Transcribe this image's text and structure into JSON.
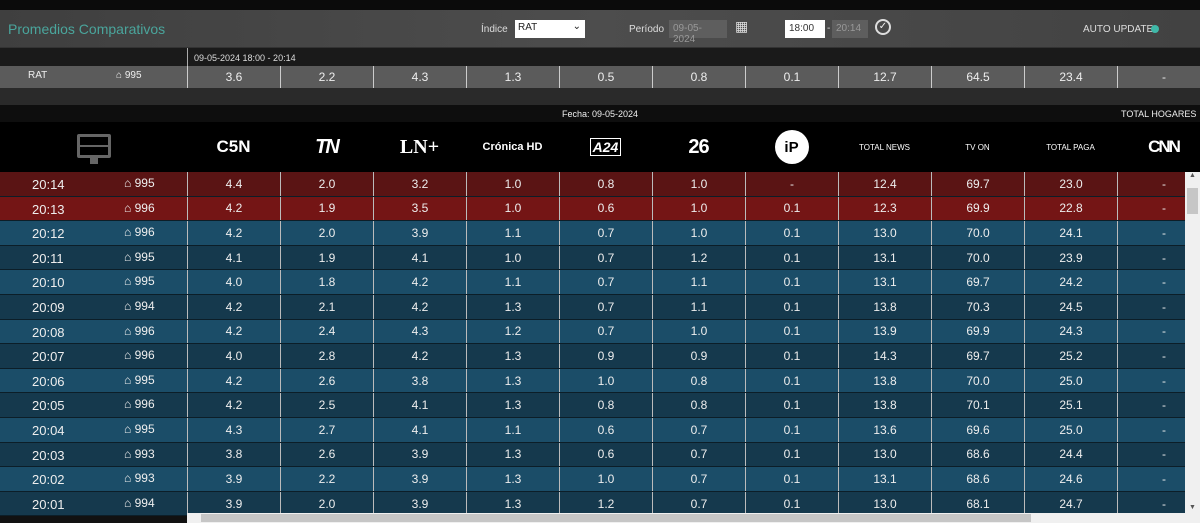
{
  "header": {
    "title": "Promedios Comparativos",
    "indice_label": "Índice",
    "indice_value": "RAT",
    "periodo_label": "Período",
    "periodo_value": "09-05-2024",
    "time_from": "18:00",
    "time_to": "20:14",
    "auto_update": "AUTO UPDATE",
    "auto_update_color": "#3fb8a8"
  },
  "range_label": "09-05-2024 18:00 - 20:14",
  "summary": {
    "label": "RAT",
    "homes": "995",
    "values": [
      "3.6",
      "2.2",
      "4.3",
      "1.3",
      "0.5",
      "0.8",
      "0.1",
      "12.7",
      "64.5",
      "23.4",
      "-"
    ]
  },
  "fecha": "Fecha: 09-05-2024",
  "total_hogares": "TOTAL HOGARES",
  "columns": [
    "C5N",
    "TN",
    "LN+",
    "Crónica HD",
    "A24",
    "26",
    "iP",
    "TOTAL NEWS",
    "TV ON",
    "TOTAL PAGA",
    "CNN"
  ],
  "rows": [
    {
      "time": "20:14",
      "homes": "995",
      "values": [
        "4.4",
        "2.0",
        "3.2",
        "1.0",
        "0.8",
        "1.0",
        "-",
        "12.4",
        "69.7",
        "23.0",
        "-"
      ]
    },
    {
      "time": "20:13",
      "homes": "996",
      "values": [
        "4.2",
        "1.9",
        "3.5",
        "1.0",
        "0.6",
        "1.0",
        "0.1",
        "12.3",
        "69.9",
        "22.8",
        "-"
      ]
    },
    {
      "time": "20:12",
      "homes": "996",
      "values": [
        "4.2",
        "2.0",
        "3.9",
        "1.1",
        "0.7",
        "1.0",
        "0.1",
        "13.0",
        "70.0",
        "24.1",
        "-"
      ]
    },
    {
      "time": "20:11",
      "homes": "995",
      "values": [
        "4.1",
        "1.9",
        "4.1",
        "1.0",
        "0.7",
        "1.2",
        "0.1",
        "13.1",
        "70.0",
        "23.9",
        "-"
      ]
    },
    {
      "time": "20:10",
      "homes": "995",
      "values": [
        "4.0",
        "1.8",
        "4.2",
        "1.1",
        "0.7",
        "1.1",
        "0.1",
        "13.1",
        "69.7",
        "24.2",
        "-"
      ]
    },
    {
      "time": "20:09",
      "homes": "994",
      "values": [
        "4.2",
        "2.1",
        "4.2",
        "1.3",
        "0.7",
        "1.1",
        "0.1",
        "13.8",
        "70.3",
        "24.5",
        "-"
      ]
    },
    {
      "time": "20:08",
      "homes": "996",
      "values": [
        "4.2",
        "2.4",
        "4.3",
        "1.2",
        "0.7",
        "1.0",
        "0.1",
        "13.9",
        "69.9",
        "24.3",
        "-"
      ]
    },
    {
      "time": "20:07",
      "homes": "996",
      "values": [
        "4.0",
        "2.8",
        "4.2",
        "1.3",
        "0.9",
        "0.9",
        "0.1",
        "14.3",
        "69.7",
        "25.2",
        "-"
      ]
    },
    {
      "time": "20:06",
      "homes": "995",
      "values": [
        "4.2",
        "2.6",
        "3.8",
        "1.3",
        "1.0",
        "0.8",
        "0.1",
        "13.8",
        "70.0",
        "25.0",
        "-"
      ]
    },
    {
      "time": "20:05",
      "homes": "996",
      "values": [
        "4.2",
        "2.5",
        "4.1",
        "1.3",
        "0.8",
        "0.8",
        "0.1",
        "13.8",
        "70.1",
        "25.1",
        "-"
      ]
    },
    {
      "time": "20:04",
      "homes": "995",
      "values": [
        "4.3",
        "2.7",
        "4.1",
        "1.1",
        "0.6",
        "0.7",
        "0.1",
        "13.6",
        "69.6",
        "25.0",
        "-"
      ]
    },
    {
      "time": "20:03",
      "homes": "993",
      "values": [
        "3.8",
        "2.6",
        "3.9",
        "1.3",
        "0.6",
        "0.7",
        "0.1",
        "13.0",
        "68.6",
        "24.4",
        "-"
      ]
    },
    {
      "time": "20:02",
      "homes": "993",
      "values": [
        "3.9",
        "2.2",
        "3.9",
        "1.3",
        "1.0",
        "0.7",
        "0.1",
        "13.1",
        "68.6",
        "24.6",
        "-"
      ]
    },
    {
      "time": "20:01",
      "homes": "994",
      "values": [
        "3.9",
        "2.0",
        "3.9",
        "1.3",
        "1.2",
        "0.7",
        "0.1",
        "13.0",
        "68.1",
        "24.7",
        "-"
      ]
    }
  ]
}
